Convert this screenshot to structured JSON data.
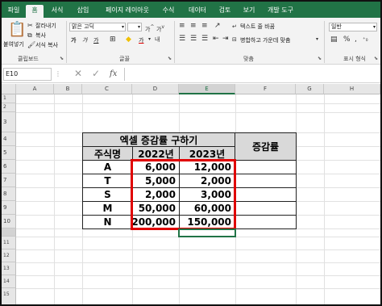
{
  "tabs": [
    "파일",
    "홈",
    "서식",
    "삽입",
    "페이지 레이아웃",
    "수식",
    "데이터",
    "검토",
    "보기",
    "개발 도구"
  ],
  "ribbon": {
    "clipboard": {
      "paste": "붙여넣기",
      "cut": "잘라내기",
      "copy": "복사",
      "format_painter": "서식 복사",
      "label": "클립보드"
    },
    "font": {
      "name": "맑은 고딕",
      "bold": "가",
      "italic": "가",
      "underline": "가",
      "color_letter": "가",
      "label": "글꼴"
    },
    "alignment": {
      "wrap": "텍스트 줄 바꿈",
      "merge": "병합하고 가운데 맞춤",
      "label": "맞춤"
    },
    "number": {
      "format": "일반",
      "label": "표시 형식"
    }
  },
  "formula_bar": {
    "name_box": "E10",
    "fx": "fx"
  },
  "columns": [
    "A",
    "B",
    "C",
    "D",
    "E",
    "F",
    "G",
    "H"
  ],
  "rows": [
    "1",
    "2",
    "3",
    "4",
    "5",
    "6",
    "7",
    "8",
    "9",
    "10",
    "11",
    "12",
    "13",
    "14",
    "15"
  ],
  "table": {
    "title": "엑셀 증감률 구하기",
    "result_header": "증감률",
    "headers": [
      "주식명",
      "2022년",
      "2023년"
    ],
    "rows": [
      [
        "A",
        "6,000",
        "12,000"
      ],
      [
        "T",
        "5,000",
        "2,000"
      ],
      [
        "S",
        "2,000",
        "3,000"
      ],
      [
        "M",
        "50,000",
        "60,000"
      ],
      [
        "N",
        "200,000",
        "150,000"
      ]
    ]
  },
  "colors": {
    "brand": "#217346",
    "highlight": "#e00000",
    "header_fill": "#d9d9d9"
  }
}
